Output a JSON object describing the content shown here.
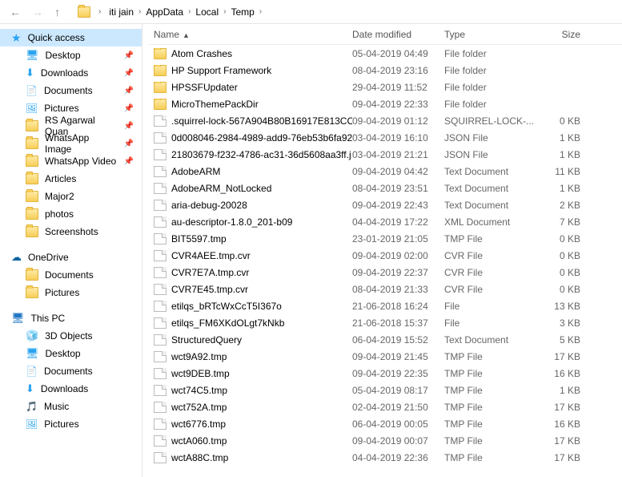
{
  "breadcrumb": {
    "items": [
      "iti jain",
      "AppData",
      "Local",
      "Temp"
    ]
  },
  "nav": {
    "quick_access": "Quick access",
    "quick_items": [
      {
        "label": "Desktop",
        "icon": "desktop",
        "pinned": true
      },
      {
        "label": "Downloads",
        "icon": "downloads",
        "pinned": true
      },
      {
        "label": "Documents",
        "icon": "docs",
        "pinned": true
      },
      {
        "label": "Pictures",
        "icon": "pics",
        "pinned": true
      },
      {
        "label": "RS Agarwal Quan",
        "icon": "folder",
        "pinned": true
      },
      {
        "label": "WhatsApp Image",
        "icon": "folder",
        "pinned": true
      },
      {
        "label": "WhatsApp Video",
        "icon": "folder",
        "pinned": true
      },
      {
        "label": "Articles",
        "icon": "folder",
        "pinned": false
      },
      {
        "label": "Major2",
        "icon": "folder",
        "pinned": false
      },
      {
        "label": "photos",
        "icon": "folder",
        "pinned": false
      },
      {
        "label": "Screenshots",
        "icon": "folder",
        "pinned": false
      }
    ],
    "onedrive": "OneDrive",
    "onedrive_items": [
      {
        "label": "Documents",
        "icon": "folder"
      },
      {
        "label": "Pictures",
        "icon": "folder"
      }
    ],
    "this_pc": "This PC",
    "this_pc_items": [
      {
        "label": "3D Objects",
        "icon": "3d"
      },
      {
        "label": "Desktop",
        "icon": "desktop"
      },
      {
        "label": "Documents",
        "icon": "docs"
      },
      {
        "label": "Downloads",
        "icon": "downloads"
      },
      {
        "label": "Music",
        "icon": "music"
      },
      {
        "label": "Pictures",
        "icon": "pics"
      }
    ]
  },
  "columns": {
    "name": "Name",
    "date": "Date modified",
    "type": "Type",
    "size": "Size"
  },
  "rows": [
    {
      "icon": "folder",
      "name": "Atom Crashes",
      "date": "05-04-2019 04:49",
      "type": "File folder",
      "size": ""
    },
    {
      "icon": "folder",
      "name": "HP Support Framework",
      "date": "08-04-2019 23:16",
      "type": "File folder",
      "size": ""
    },
    {
      "icon": "folder",
      "name": "HPSSFUpdater",
      "date": "29-04-2019 11:52",
      "type": "File folder",
      "size": ""
    },
    {
      "icon": "folder",
      "name": "MicroThemePackDir",
      "date": "09-04-2019 22:33",
      "type": "File folder",
      "size": ""
    },
    {
      "icon": "file",
      "name": ".squirrel-lock-567A904B80B16917E813CC...",
      "date": "09-04-2019 01:12",
      "type": "SQUIRREL-LOCK-...",
      "size": "0 KB"
    },
    {
      "icon": "file",
      "name": "0d008046-2984-4989-add9-76eb53b6fa92...",
      "date": "03-04-2019 16:10",
      "type": "JSON File",
      "size": "1 KB"
    },
    {
      "icon": "file",
      "name": "21803679-f232-4786-ac31-36d5608aa3ff.j...",
      "date": "03-04-2019 21:21",
      "type": "JSON File",
      "size": "1 KB"
    },
    {
      "icon": "file",
      "name": "AdobeARM",
      "date": "09-04-2019 04:42",
      "type": "Text Document",
      "size": "11 KB"
    },
    {
      "icon": "file",
      "name": "AdobeARM_NotLocked",
      "date": "08-04-2019 23:51",
      "type": "Text Document",
      "size": "1 KB"
    },
    {
      "icon": "file",
      "name": "aria-debug-20028",
      "date": "09-04-2019 22:43",
      "type": "Text Document",
      "size": "2 KB"
    },
    {
      "icon": "file",
      "name": "au-descriptor-1.8.0_201-b09",
      "date": "04-04-2019 17:22",
      "type": "XML Document",
      "size": "7 KB"
    },
    {
      "icon": "file",
      "name": "BIT5597.tmp",
      "date": "23-01-2019 21:05",
      "type": "TMP File",
      "size": "0 KB"
    },
    {
      "icon": "file",
      "name": "CVR4AEE.tmp.cvr",
      "date": "09-04-2019 02:00",
      "type": "CVR File",
      "size": "0 KB"
    },
    {
      "icon": "file",
      "name": "CVR7E7A.tmp.cvr",
      "date": "09-04-2019 22:37",
      "type": "CVR File",
      "size": "0 KB"
    },
    {
      "icon": "file",
      "name": "CVR7E45.tmp.cvr",
      "date": "08-04-2019 21:33",
      "type": "CVR File",
      "size": "0 KB"
    },
    {
      "icon": "file",
      "name": "etilqs_bRTcWxCcT5I367o",
      "date": "21-06-2018 16:24",
      "type": "File",
      "size": "13 KB"
    },
    {
      "icon": "file",
      "name": "etilqs_FM6XKdOLgt7kNkb",
      "date": "21-06-2018 15:37",
      "type": "File",
      "size": "3 KB"
    },
    {
      "icon": "file",
      "name": "StructuredQuery",
      "date": "06-04-2019 15:52",
      "type": "Text Document",
      "size": "5 KB"
    },
    {
      "icon": "file",
      "name": "wct9A92.tmp",
      "date": "09-04-2019 21:45",
      "type": "TMP File",
      "size": "17 KB"
    },
    {
      "icon": "file",
      "name": "wct9DEB.tmp",
      "date": "09-04-2019 22:35",
      "type": "TMP File",
      "size": "16 KB"
    },
    {
      "icon": "file",
      "name": "wct74C5.tmp",
      "date": "05-04-2019 08:17",
      "type": "TMP File",
      "size": "1 KB"
    },
    {
      "icon": "file",
      "name": "wct752A.tmp",
      "date": "02-04-2019 21:50",
      "type": "TMP File",
      "size": "17 KB"
    },
    {
      "icon": "file",
      "name": "wct6776.tmp",
      "date": "06-04-2019 00:05",
      "type": "TMP File",
      "size": "16 KB"
    },
    {
      "icon": "file",
      "name": "wctA060.tmp",
      "date": "09-04-2019 00:07",
      "type": "TMP File",
      "size": "17 KB"
    },
    {
      "icon": "file",
      "name": "wctA88C.tmp",
      "date": "04-04-2019 22:36",
      "type": "TMP File",
      "size": "17 KB"
    }
  ]
}
